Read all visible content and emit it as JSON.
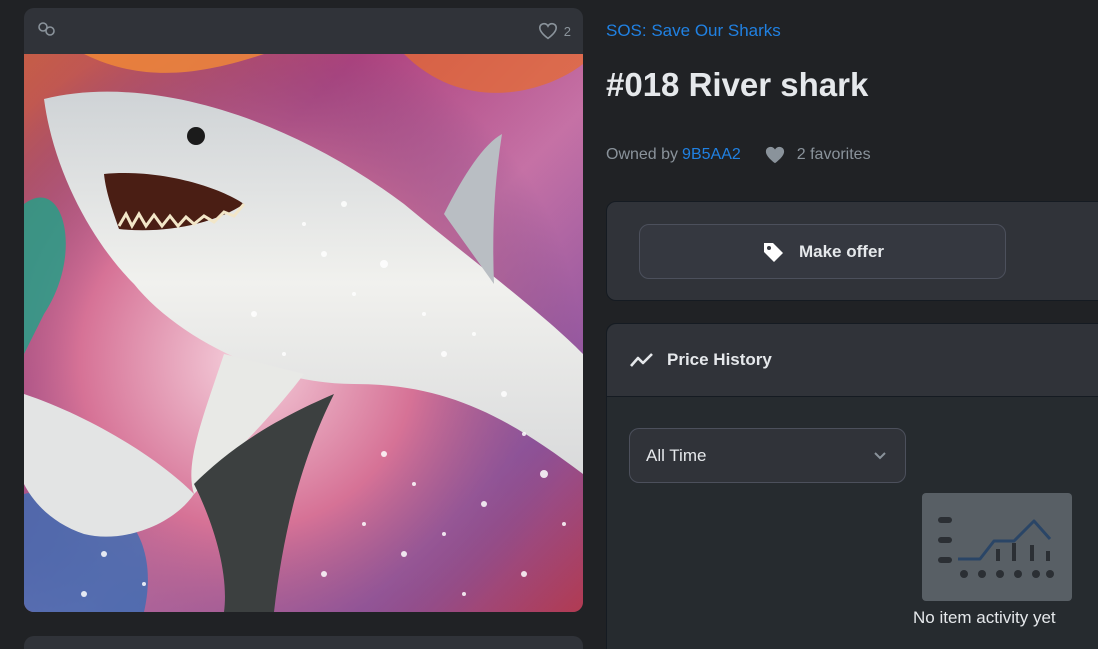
{
  "colors": {
    "background": "#202225",
    "panel": "#303339",
    "link": "#2081e2",
    "text": "#e5e8eb",
    "muted": "#8a939b"
  },
  "left_card": {
    "link_icon": "link-icon",
    "favorite_icon": "heart-outline-icon",
    "favorite_count": "2"
  },
  "item": {
    "collection": "SOS: Save Our Sharks",
    "title": "#018 River shark",
    "owned_by_label": "Owned by",
    "owner": "9B5AA2",
    "favorites_icon": "heart-filled-icon",
    "favorites_text": "2 favorites"
  },
  "offer": {
    "icon": "tag-icon",
    "label": "Make offer"
  },
  "price_history": {
    "icon": "trend-line-icon",
    "title": "Price History",
    "range_selected": "All Time",
    "range_icon": "chevron-down-icon",
    "empty_illustration": "empty-chart-icon",
    "empty_message": "No item activity yet"
  }
}
